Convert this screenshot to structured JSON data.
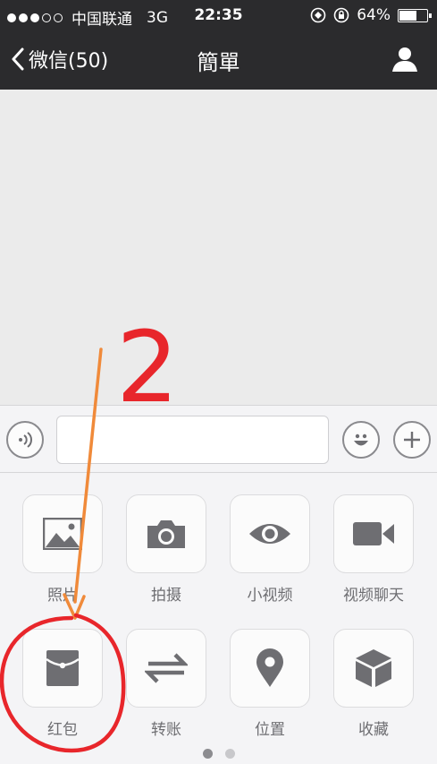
{
  "status": {
    "carrier": "中国联通",
    "network": "3G",
    "time": "22:35",
    "battery": "64%",
    "battery_level": 0.64,
    "signal_bars": 3
  },
  "nav": {
    "back_label": "微信(50)",
    "title": "簡單"
  },
  "panel": {
    "items": [
      {
        "label": "照片",
        "icon": "photo-icon"
      },
      {
        "label": "拍摄",
        "icon": "camera-icon"
      },
      {
        "label": "小视频",
        "icon": "eye-icon"
      },
      {
        "label": "视频聊天",
        "icon": "video-camera-icon"
      },
      {
        "label": "红包",
        "icon": "red-packet-icon"
      },
      {
        "label": "转账",
        "icon": "transfer-icon"
      },
      {
        "label": "位置",
        "icon": "location-pin-icon"
      },
      {
        "label": "收藏",
        "icon": "favorites-cube-icon"
      }
    ],
    "page_count": 2,
    "active_page": 1
  },
  "annotation": {
    "number": "2",
    "circle_color": "#e8262b",
    "arrow_color": "#f08a3a"
  },
  "colors": {
    "navbar": "#2b2b2d",
    "icon_gray": "#6e6e72"
  }
}
